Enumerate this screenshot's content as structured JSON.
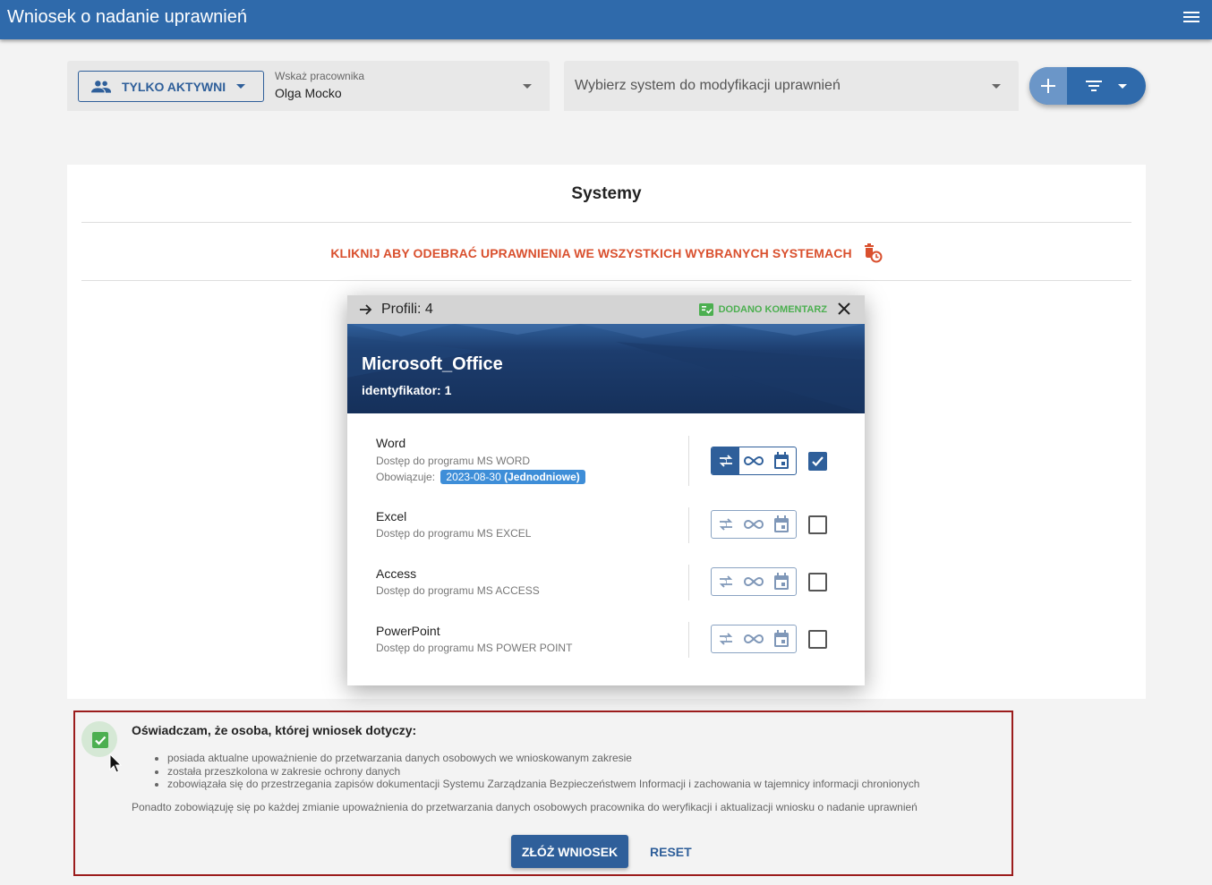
{
  "app": {
    "title": "Wniosek o nadanie uprawnień"
  },
  "filters": {
    "active_only_label": "TYLKO AKTYWNI",
    "employee_label": "Wskaż pracownika",
    "employee_value": "Olga Mocko",
    "system_placeholder": "Wybierz system do modyfikacji uprawnień"
  },
  "panel": {
    "title": "Systemy",
    "revoke_all_label": "KLIKNIJ ABY ODEBRAĆ UPRAWNIENIA WE WSZYSTKICH WYBRANYCH SYSTEMACH"
  },
  "dialog": {
    "profiles_label": "Profili: 4",
    "comment_badge": "DODANO KOMENTARZ",
    "system_name": "Microsoft_Office",
    "identifier": "identyfikator: 1",
    "profiles": [
      {
        "name": "Word",
        "description": "Dostęp do programu MS WORD",
        "valid_label": "Obowiązuje:",
        "valid_date": "2023-08-30",
        "valid_type": "(Jednodniowe)",
        "checked": true,
        "selected_mode": "one-time"
      },
      {
        "name": "Excel",
        "description": "Dostęp do programu MS EXCEL",
        "checked": false
      },
      {
        "name": "Access",
        "description": "Dostęp do programu MS ACCESS",
        "checked": false
      },
      {
        "name": "PowerPoint",
        "description": "Dostęp do programu MS POWER POINT",
        "checked": false
      }
    ]
  },
  "declaration": {
    "checked": true,
    "title": "Oświadczam, że osoba, której wniosek dotyczy:",
    "items": [
      "posiada aktualne upoważnienie do przetwarzania danych osobowych we wnioskowanym zakresie",
      "została przeszkolona w zakresie ochrony danych",
      "zobowiązała się do przestrzegania zapisów dokumentacji Systemu Zarządzania Bezpieczeństwem Informacji i zachowania w tajemnicy informacji chronionych"
    ],
    "note": "Ponadto zobowiązuję się po każdej zmianie upoważnienia do przetwarzania danych osobowych pracownika do weryfikacji i aktualizacji wniosku o nadanie uprawnień",
    "submit_label": "ZŁÓŻ WNIOSEK",
    "reset_label": "RESET"
  },
  "colors": {
    "primary": "#2f6aab",
    "accent_dark": "#2f5f9a",
    "danger": "#d9502e",
    "success": "#4caf50",
    "chip": "#3e8ed8"
  }
}
